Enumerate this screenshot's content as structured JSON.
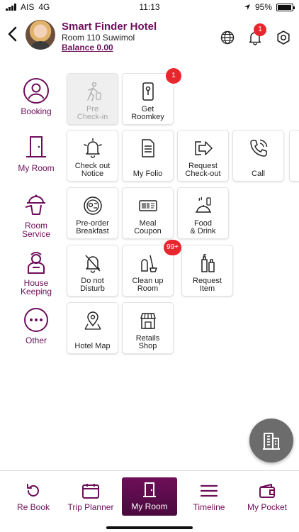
{
  "status_bar": {
    "carrier": "AIS",
    "network": "4G",
    "time": "11:13",
    "battery": "95%",
    "battery_level": 0.95
  },
  "header": {
    "hotel_name": "Smart Finder Hotel",
    "room_line": "Room 110 Suwimol",
    "balance": "Balance 0.00",
    "notification_count": "1",
    "icons": [
      "back-icon",
      "globe-icon",
      "bell-icon",
      "settings-icon"
    ]
  },
  "theme": {
    "primary": "#6e0e5a",
    "badge": "#e8262d",
    "disabled_bg": "#efefef",
    "fab": "#6c6c6c"
  },
  "categories": [
    {
      "label": "Booking",
      "icon": "user-circle-icon",
      "tiles": [
        {
          "label": "Pre\nCheck-in",
          "icon": "walking-person-icon",
          "disabled": true
        },
        {
          "label": "Get\nRoomkey",
          "icon": "keycard-icon",
          "badge": "1"
        }
      ]
    },
    {
      "label": "My Room",
      "icon": "door-icon",
      "tiles": [
        {
          "label": "Check out\nNotice",
          "icon": "bell-notice-icon"
        },
        {
          "label": "My Folio",
          "icon": "document-icon"
        },
        {
          "label": "Request\nCheck-out",
          "icon": "exit-arrow-icon"
        },
        {
          "label": "Call",
          "icon": "phone-icon"
        }
      ]
    },
    {
      "label": "Room\nService",
      "icon": "cloche-waiter-icon",
      "tiles": [
        {
          "label": "Pre-order\nBreakfast",
          "icon": "plate-icon"
        },
        {
          "label": "Meal\nCoupon",
          "icon": "coupon-icon"
        },
        {
          "label": "Food\n& Drink",
          "icon": "food-drink-icon"
        }
      ]
    },
    {
      "label": "House\nKeeping",
      "icon": "housekeeper-icon",
      "tiles": [
        {
          "label": "Do not\nDisturb",
          "icon": "bell-off-icon"
        },
        {
          "label": "Clean up\nRoom",
          "icon": "cleaning-icon",
          "badge": "99+"
        },
        {
          "label": "Request\nItem",
          "icon": "toiletries-icon"
        }
      ]
    },
    {
      "label": "Other",
      "icon": "more-dots-icon",
      "tiles": [
        {
          "label": "Hotel Map",
          "icon": "map-pin-icon"
        },
        {
          "label": "Retails\nShop",
          "icon": "shop-icon"
        }
      ]
    }
  ],
  "bottom_nav": [
    {
      "label": "Re Book",
      "icon": "rebook-icon",
      "active": false
    },
    {
      "label": "Trip Planner",
      "icon": "calendar-icon",
      "active": false
    },
    {
      "label": "My Room",
      "icon": "door-icon",
      "active": true
    },
    {
      "label": "Timeline",
      "icon": "menu-lines-icon",
      "active": false
    },
    {
      "label": "My Pocket",
      "icon": "wallet-icon",
      "active": false
    }
  ]
}
